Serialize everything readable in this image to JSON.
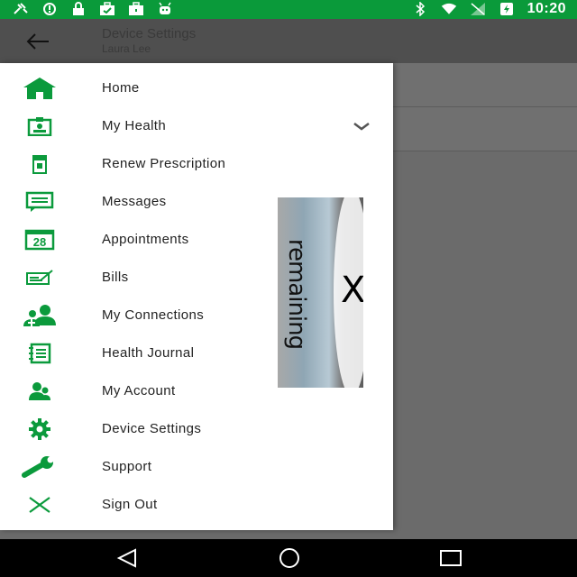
{
  "status_bar": {
    "time": "10:20",
    "left_icons": [
      "satellite-icon",
      "alert-icon",
      "lock-icon",
      "briefcase-check-icon",
      "briefcase-icon",
      "android-icon"
    ],
    "right_icons": [
      "bluetooth-icon",
      "wifi-icon",
      "signal-icon",
      "battery-icon"
    ]
  },
  "app_bar": {
    "title": "Device Settings",
    "subtitle": "Laura Lee",
    "back_icon": "arrow-left-icon"
  },
  "drawer": {
    "items": [
      {
        "label": "Home",
        "icon": "home-icon"
      },
      {
        "label": "My Health",
        "icon": "id-badge-icon",
        "expandable": true
      },
      {
        "label": "Renew Prescription",
        "icon": "prescription-icon"
      },
      {
        "label": "Messages",
        "icon": "message-icon"
      },
      {
        "label": "Appointments",
        "icon": "calendar-icon",
        "calendar_day": "28"
      },
      {
        "label": "Bills",
        "icon": "bill-icon"
      },
      {
        "label": "My Connections",
        "icon": "connections-icon"
      },
      {
        "label": "Health Journal",
        "icon": "journal-icon"
      },
      {
        "label": "My Account",
        "icon": "account-icon"
      },
      {
        "label": "Device Settings",
        "icon": "gear-icon"
      },
      {
        "label": "Support",
        "icon": "wrench-icon"
      },
      {
        "label": "Sign Out",
        "icon": "close-icon"
      }
    ]
  },
  "overlay_ad": {
    "text": "remaining",
    "close_glyph": "X"
  },
  "colors": {
    "brand_green": "#0a9a3a",
    "icon_green": "#0b9a3c"
  },
  "nav_bar": {
    "buttons": [
      "back-triangle-icon",
      "home-circle-icon",
      "recents-square-icon"
    ]
  }
}
